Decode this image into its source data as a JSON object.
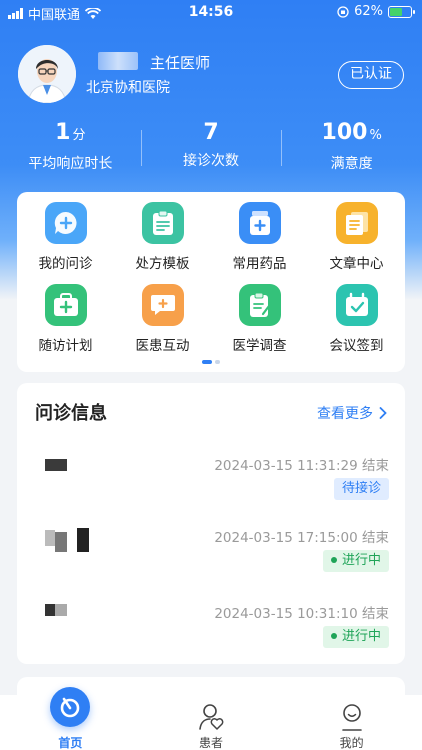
{
  "status_bar": {
    "carrier": "中国联通",
    "time": "14:56",
    "battery": "62%"
  },
  "profile": {
    "title": "主任医师",
    "hospital": "北京协和医院",
    "verified_label": "已认证"
  },
  "stats": [
    {
      "value": "1",
      "unit": "分",
      "label": "平均响应时长"
    },
    {
      "value": "7",
      "unit": "",
      "label": "接诊次数"
    },
    {
      "value": "100",
      "unit": "%",
      "label": "满意度"
    }
  ],
  "features": [
    {
      "label": "我的问诊",
      "icon": "consultation-icon",
      "color": "#4aa6f8"
    },
    {
      "label": "处方模板",
      "icon": "prescription-icon",
      "color": "#3cc3a2"
    },
    {
      "label": "常用药品",
      "icon": "medicine-bottle-icon",
      "color": "#3a8ef6"
    },
    {
      "label": "文章中心",
      "icon": "article-icon",
      "color": "#f7b22c"
    },
    {
      "label": "随访计划",
      "icon": "medical-kit-icon",
      "color": "#34c27a"
    },
    {
      "label": "医患互动",
      "icon": "chat-bubble-icon",
      "color": "#f7a04a"
    },
    {
      "label": "医学调查",
      "icon": "survey-icon",
      "color": "#34c27a"
    },
    {
      "label": "会议签到",
      "icon": "calendar-check-icon",
      "color": "#2cc4b0"
    }
  ],
  "consultations": {
    "title": "问诊信息",
    "more_label": "查看更多",
    "items": [
      {
        "time": "2024-03-15 11:31:29 结束",
        "status": "待接诊",
        "state": "wait"
      },
      {
        "time": "2024-03-15 17:15:00 结束",
        "status": "进行中",
        "state": "going"
      },
      {
        "time": "2024-03-15 10:31:10 结束",
        "status": "进行中",
        "state": "going"
      }
    ]
  },
  "tabbar": {
    "home": "首页",
    "patients": "患者",
    "mine": "我的"
  },
  "colors": {
    "primary": "#2f7ff4",
    "success": "#1fa458"
  }
}
